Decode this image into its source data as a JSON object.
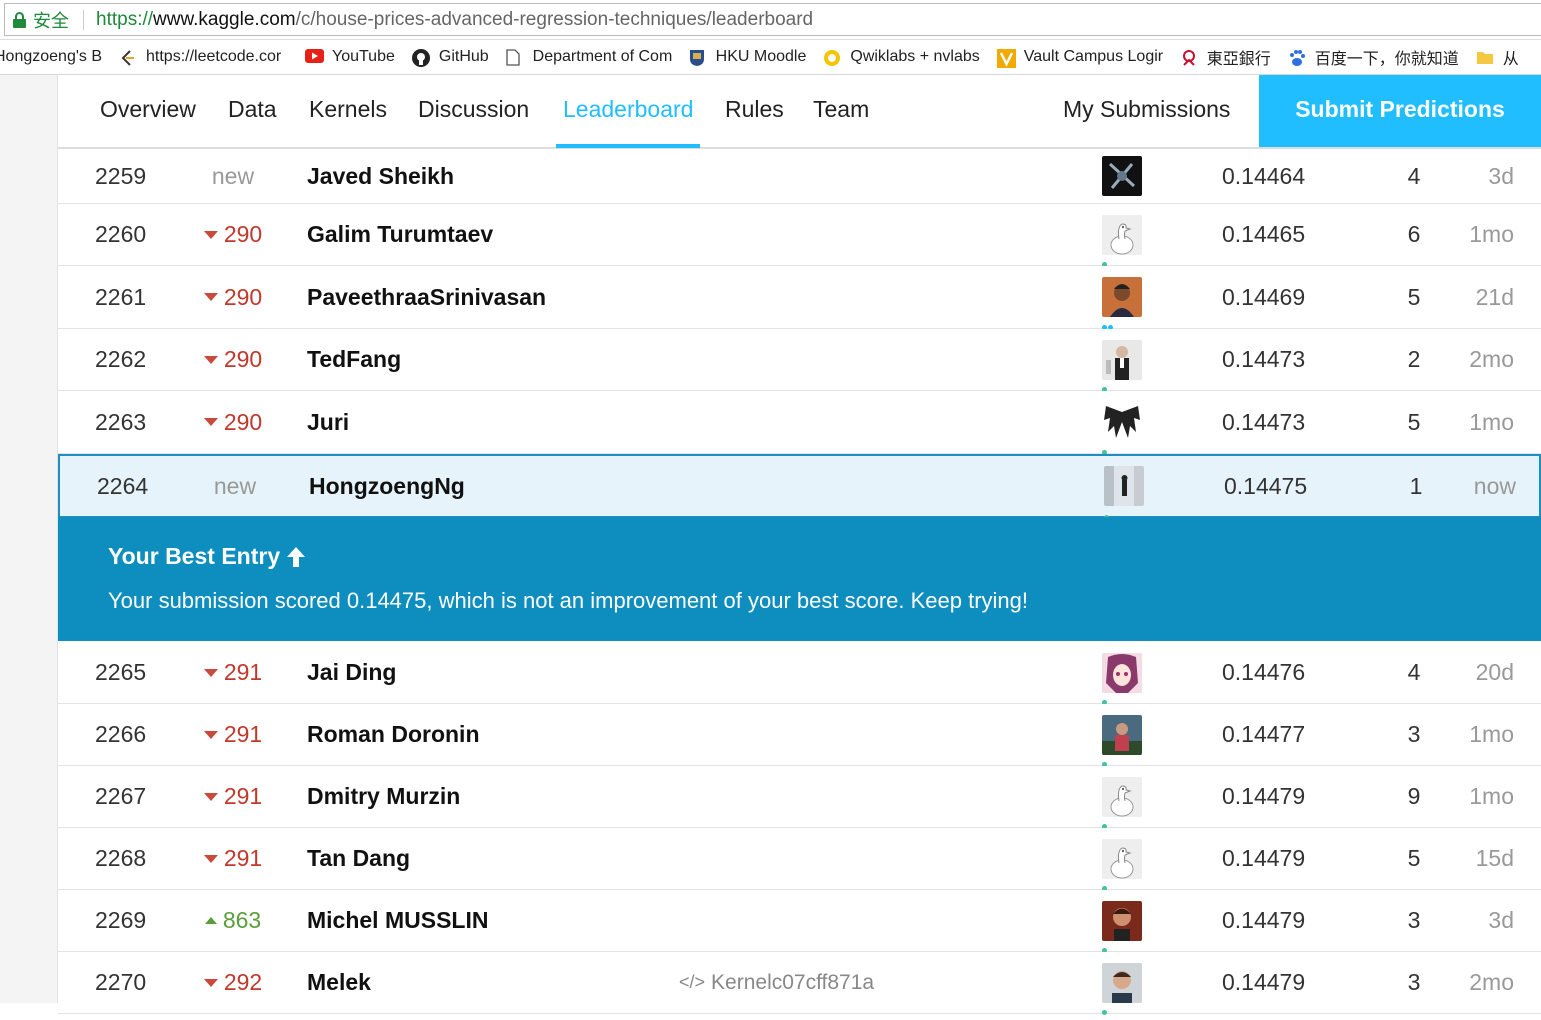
{
  "browser": {
    "secure_label": "安全",
    "url_scheme": "https://",
    "url_host": "www.kaggle.com",
    "url_path": "/c/house-prices-advanced-regression-techniques/leaderboard"
  },
  "bookmarks": [
    {
      "label": "Hongzoeng's Bl",
      "icon": "blog-icon"
    },
    {
      "label": "https://leetcode.cor",
      "icon": "leetcode-icon"
    },
    {
      "label": "YouTube",
      "icon": "youtube-icon"
    },
    {
      "label": "GitHub",
      "icon": "github-icon"
    },
    {
      "label": "Department of Com",
      "icon": "page-icon"
    },
    {
      "label": "HKU Moodle",
      "icon": "hku-icon"
    },
    {
      "label": "Qwiklabs + nvlabs",
      "icon": "qwiklabs-icon"
    },
    {
      "label": "Vault Campus Logir",
      "icon": "vault-icon"
    },
    {
      "label": "東亞銀行",
      "icon": "bea-icon"
    },
    {
      "label": "百度一下，你就知道",
      "icon": "baidu-icon"
    },
    {
      "label": "从",
      "icon": "folder-icon"
    }
  ],
  "nav": {
    "tabs": [
      "Overview",
      "Data",
      "Kernels",
      "Discussion",
      "Leaderboard",
      "Rules",
      "Team"
    ],
    "active_tab": "Leaderboard",
    "my_submissions": "My Submissions",
    "submit_button": "Submit Predictions"
  },
  "leaderboard": {
    "rows": [
      {
        "rank": "2259",
        "change": "new",
        "change_type": "new",
        "name": "Javed Sheikh",
        "score": "0.14464",
        "entries": "4",
        "last": "3d",
        "tier": "contributor",
        "avatar": "dark"
      },
      {
        "rank": "2260",
        "change": "290",
        "change_type": "down",
        "name": "Galim Turumtaev",
        "score": "0.14465",
        "entries": "6",
        "last": "1mo",
        "tier": "novice",
        "avatar": "goose"
      },
      {
        "rank": "2261",
        "change": "290",
        "change_type": "down",
        "name": "PaveethraaSrinivasan",
        "score": "0.14469",
        "entries": "5",
        "last": "21d",
        "tier": "contributor",
        "avatar": "photo-warm"
      },
      {
        "rank": "2262",
        "change": "290",
        "change_type": "down",
        "name": "TedFang",
        "score": "0.14473",
        "entries": "2",
        "last": "2mo",
        "tier": "novice",
        "avatar": "photo-suit"
      },
      {
        "rank": "2263",
        "change": "290",
        "change_type": "down",
        "name": "Juri",
        "score": "0.14473",
        "entries": "5",
        "last": "1mo",
        "tier": "novice",
        "avatar": "wings"
      },
      {
        "rank": "2264",
        "change": "new",
        "change_type": "new",
        "name": "HongzoengNg",
        "score": "0.14475",
        "entries": "1",
        "last": "now",
        "tier": "novice",
        "avatar": "snow",
        "is_me": true
      },
      {
        "rank": "2265",
        "change": "291",
        "change_type": "down",
        "name": "Jai Ding",
        "score": "0.14476",
        "entries": "4",
        "last": "20d",
        "tier": "novice",
        "avatar": "anime"
      },
      {
        "rank": "2266",
        "change": "291",
        "change_type": "down",
        "name": "Roman Doronin",
        "score": "0.14477",
        "entries": "3",
        "last": "1mo",
        "tier": "novice",
        "avatar": "photo-blue"
      },
      {
        "rank": "2267",
        "change": "291",
        "change_type": "down",
        "name": "Dmitry Murzin",
        "score": "0.14479",
        "entries": "9",
        "last": "1mo",
        "tier": "novice",
        "avatar": "goose"
      },
      {
        "rank": "2268",
        "change": "291",
        "change_type": "down",
        "name": "Tan Dang",
        "score": "0.14479",
        "entries": "5",
        "last": "15d",
        "tier": "novice",
        "avatar": "goose"
      },
      {
        "rank": "2269",
        "change": "863",
        "change_type": "up",
        "name": "Michel MUSSLIN",
        "score": "0.14479",
        "entries": "3",
        "last": "3d",
        "tier": "novice",
        "avatar": "photo-red"
      },
      {
        "rank": "2270",
        "change": "292",
        "change_type": "down",
        "name": "Melek",
        "kernel": "Kernelc07cff871a",
        "score": "0.14479",
        "entries": "3",
        "last": "2mo",
        "tier": "novice",
        "avatar": "photo-face"
      }
    ]
  },
  "best_entry": {
    "title": "Your Best Entry",
    "message": "Your submission scored 0.14475, which is not an improvement of your best score. Keep trying!"
  }
}
